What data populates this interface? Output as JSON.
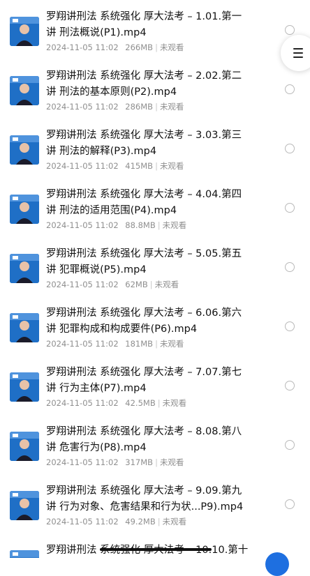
{
  "items": [
    {
      "line1": "罗翔讲刑法 系统强化 厚大法考 – 1.01.第一",
      "line2": "讲 刑法概说(P1).mp4",
      "date": "2024-11-05 11:02",
      "size": "266MB",
      "status": "未观看"
    },
    {
      "line1": "罗翔讲刑法 系统强化 厚大法考 – 2.02.第二",
      "line2": "讲 刑法的基本原则(P2).mp4",
      "date": "2024-11-05 11:02",
      "size": "286MB",
      "status": "未观看"
    },
    {
      "line1": "罗翔讲刑法 系统强化 厚大法考 – 3.03.第三",
      "line2": "讲 刑法的解释(P3).mp4",
      "date": "2024-11-05 11:02",
      "size": "415MB",
      "status": "未观看"
    },
    {
      "line1": "罗翔讲刑法 系统强化 厚大法考 – 4.04.第四",
      "line2": "讲 刑法的适用范围(P4).mp4",
      "date": "2024-11-05 11:02",
      "size": "88.8MB",
      "status": "未观看"
    },
    {
      "line1": "罗翔讲刑法 系统强化 厚大法考 – 5.05.第五",
      "line2": "讲 犯罪概说(P5).mp4",
      "date": "2024-11-05 11:02",
      "size": "62MB",
      "status": "未观看"
    },
    {
      "line1": "罗翔讲刑法 系统强化 厚大法考 – 6.06.第六",
      "line2": "讲 犯罪构成和构成要件(P6).mp4",
      "date": "2024-11-05 11:02",
      "size": "181MB",
      "status": "未观看"
    },
    {
      "line1": "罗翔讲刑法 系统强化 厚大法考 – 7.07.第七",
      "line2": "讲 行为主体(P7).mp4",
      "date": "2024-11-05 11:02",
      "size": "42.5MB",
      "status": "未观看"
    },
    {
      "line1": "罗翔讲刑法 系统强化 厚大法考 – 8.08.第八",
      "line2": "讲 危害行为(P8).mp4",
      "date": "2024-11-05 11:02",
      "size": "317MB",
      "status": "未观看"
    },
    {
      "line1": "罗翔讲刑法 系统强化 厚大法考 – 9.09.第九",
      "line2": "讲 行为对象、危害结果和行为状...P9).mp4",
      "date": "2024-11-05 11:02",
      "size": "49.2MB",
      "status": "未观看"
    },
    {
      "line1": "罗翔讲刑法 系统强化 厚大法考 – 10.10.第十",
      "line2": "",
      "date": "",
      "size": "",
      "status": ""
    }
  ],
  "icons": {
    "thumbnail": "video-thumbnail-icon",
    "select": "radio-circle-icon",
    "menu": "menu-icon"
  },
  "colors": {
    "thumbnail_bg": "#1f6fc6",
    "accent": "#1e6fe0"
  }
}
